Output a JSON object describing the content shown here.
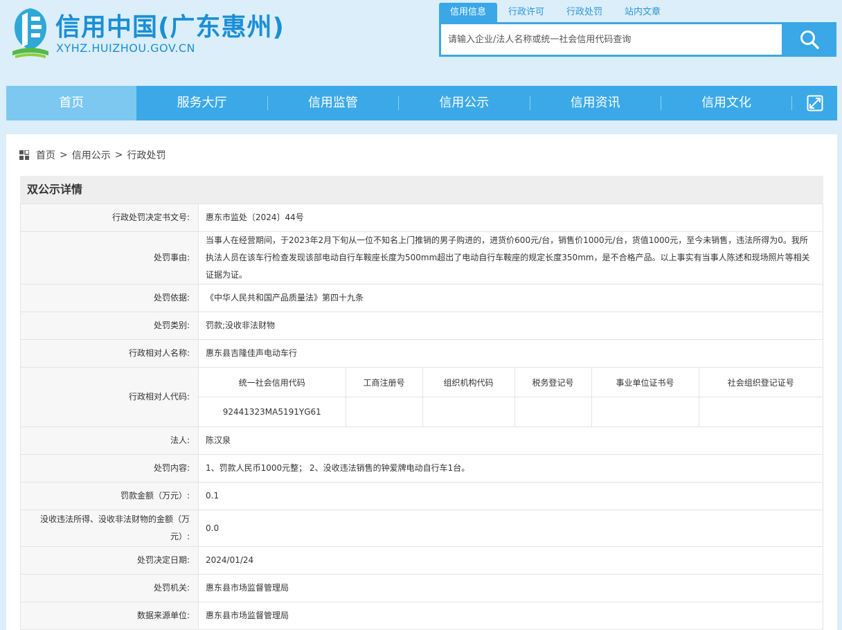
{
  "header": {
    "site_title": "信用中国(广东惠州)",
    "site_url": "XYHZ.HUIZHOU.GOV.CN",
    "logo_icon": "huizhou-logo-icon"
  },
  "search": {
    "tabs": [
      "信用信息",
      "行政许可",
      "行政处罚",
      "站内文章"
    ],
    "active_tab": "信用信息",
    "placeholder": "请输入企业/法人名称或统一社会信用代码查询",
    "value": "",
    "button_icon": "search-icon"
  },
  "nav": {
    "items": [
      "首页",
      "服务大厅",
      "信用监管",
      "信用公示",
      "信用资讯",
      "信用文化"
    ],
    "active_item": "首页",
    "expand_icon": "expand-icon"
  },
  "breadcrumb": {
    "icon": "grid-icon",
    "items": [
      "首页",
      "信用公示",
      "行政处罚"
    ],
    "separator": ">"
  },
  "detail": {
    "panel_title": "双公示详情",
    "decision_no_label": "行政处罚决定书文号:",
    "decision_no": "惠东市监处〔2024〕44号",
    "reason_label": "处罚事由:",
    "reason": "当事人在经营期间，于2023年2月下旬从一位不知名上门推销的男子购进的，进货价600元/台，销售价1000元/台，货值1000元，至今未销售，违法所得为0。我所执法人员在该车行检查发现该部电动自行车鞍座长度为500mm超出了电动自行车鞍座的规定长度350mm，是不合格产品。以上事实有当事人陈述和现场照片等相关证据为证。",
    "basis_label": "处罚依据:",
    "basis": "《中华人民共和国产品质量法》第四十九条",
    "category_label": "处罚类别:",
    "category": "罚款;没收非法财物",
    "party_name_label": "行政相对人名称:",
    "party_name": "惠东县吉隆佳声电动车行",
    "party_code_label": "行政相对人代码:",
    "code_headers": [
      "统一社会信用代码",
      "工商注册号",
      "组织机构代码",
      "税务登记号",
      "事业单位证书号",
      "社会组织登记证号"
    ],
    "code_values": [
      "92441323MA5191YG61",
      "",
      "",
      "",
      "",
      ""
    ],
    "legal_person_label": "法人:",
    "legal_person": "陈汉泉",
    "content_label": "处罚内容:",
    "content": "1、罚款人民币1000元整； 2、没收违法销售的钟爱牌电动自行车1台。",
    "fine_label": "罚款金额（万元）:",
    "fine": "0.1",
    "confiscation_label": "没收违法所得、没收非法财物的金额（万元）:",
    "confiscation": "0.0",
    "decision_date_label": "处罚决定日期:",
    "decision_date": "2024/01/24",
    "authority_label": "处罚机关:",
    "authority": "惠东县市场监督管理局",
    "source_label": "数据来源单位:",
    "source": "惠东县市场监督管理局"
  },
  "colors": {
    "brand_blue": "#1a8fd6",
    "nav_blue": "#3ba9e7",
    "nav_active": "#7cc8f1",
    "page_bg": "#dbeef9"
  }
}
